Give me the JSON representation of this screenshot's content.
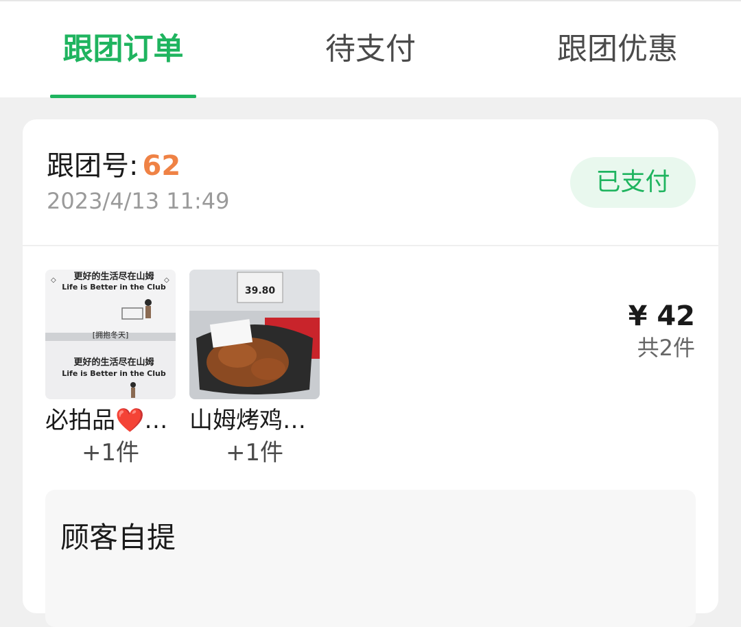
{
  "tabs": [
    {
      "label": "跟团订单",
      "active": true
    },
    {
      "label": "待支付",
      "active": false
    },
    {
      "label": "跟团优惠",
      "active": false
    }
  ],
  "order": {
    "number_label": "跟团号:",
    "number": "62",
    "time": "2023/4/13 11:49",
    "status": "已支付",
    "price": "¥ 42",
    "count": "共2件"
  },
  "products": [
    {
      "name": "必拍品❤️…",
      "qty": "+1件",
      "image_text": [
        "更好的生活尽在山姆",
        "Life is Better in the Club",
        "[拥抱冬天]",
        "更好的生活尽在山姆",
        "Life is Better in the Club"
      ]
    },
    {
      "name": "山姆烤鸡…",
      "qty": "+1件",
      "image_text": [
        "39.80"
      ]
    }
  ],
  "pickup": {
    "title": "顾客自提"
  },
  "colors": {
    "accent": "#1fb45f",
    "order_number": "#ef8245",
    "badge_bg": "#e9f8ee",
    "page_bg": "#f0f0f0"
  }
}
